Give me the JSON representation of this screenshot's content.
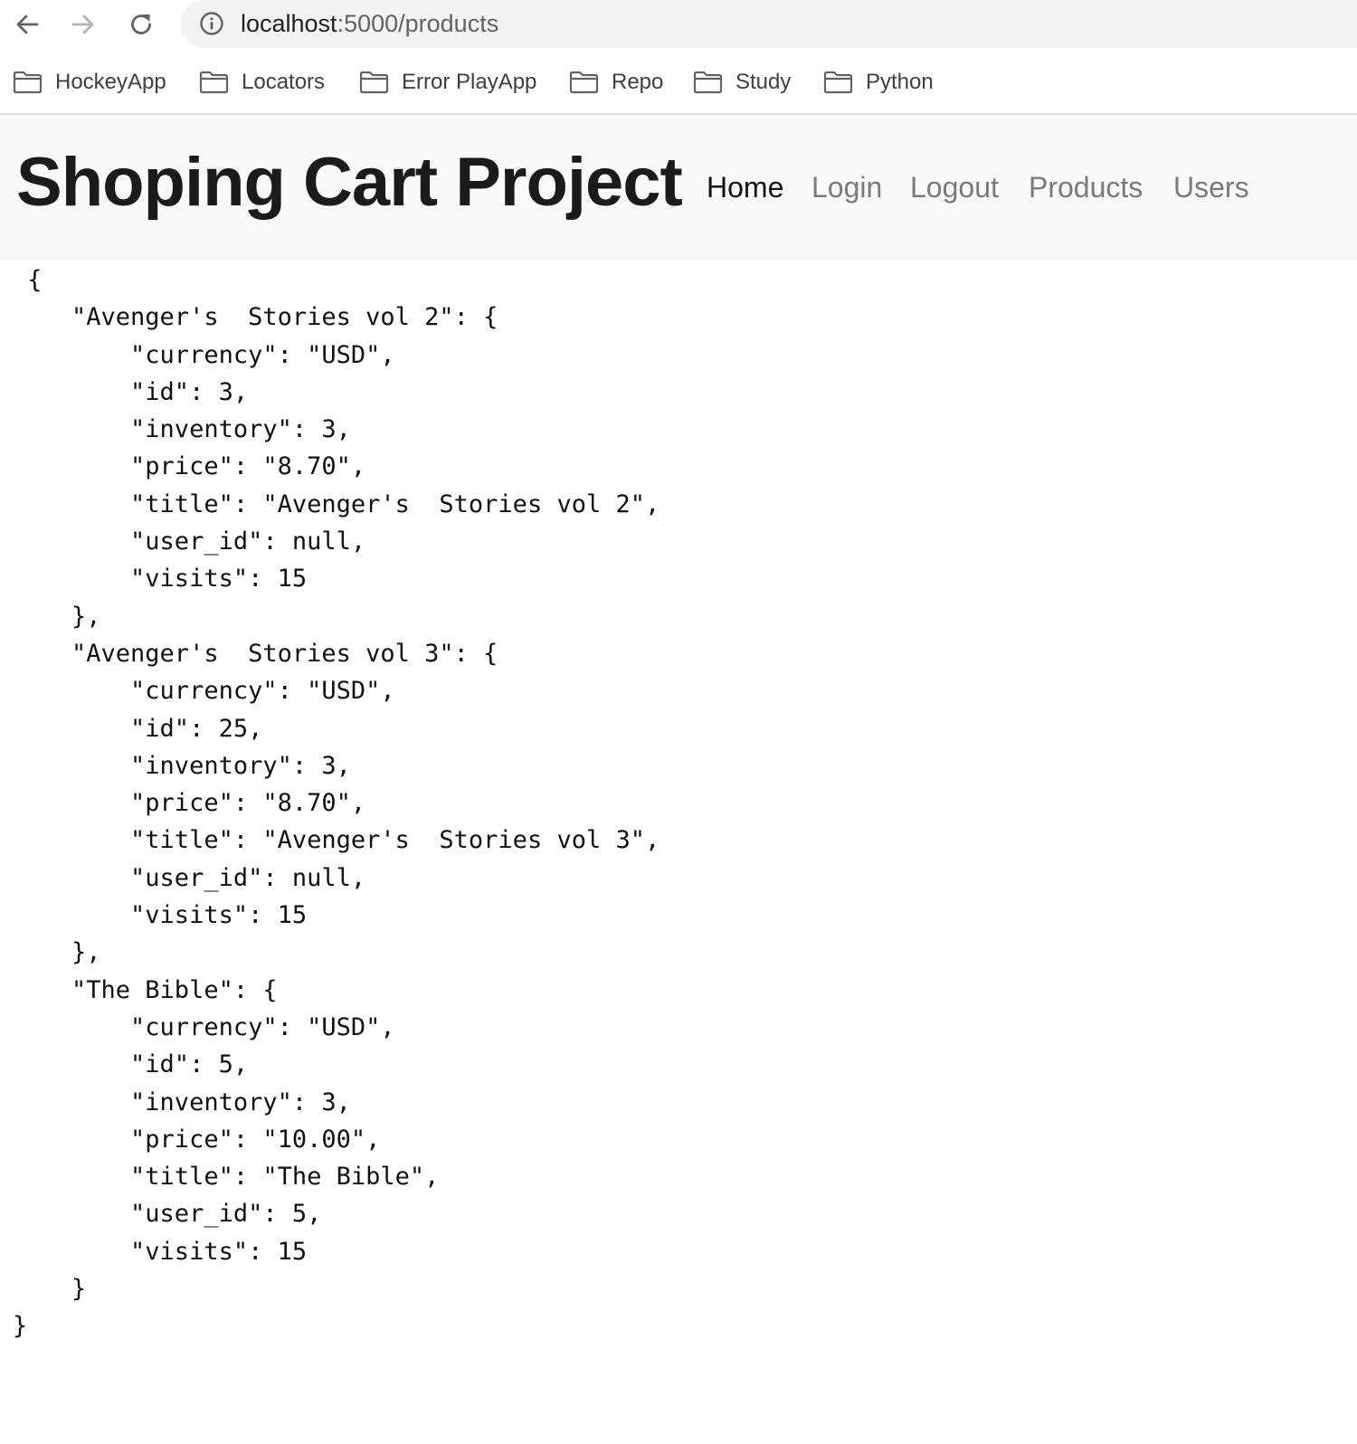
{
  "browser": {
    "url_host": "localhost",
    "url_rest": ":5000/products"
  },
  "bookmarks": [
    {
      "label": "HockeyApp"
    },
    {
      "label": "Locators"
    },
    {
      "label": "Error PlayApp"
    },
    {
      "label": "Repo"
    },
    {
      "label": "Study"
    },
    {
      "label": "Python"
    }
  ],
  "navbar": {
    "brand": "Shoping Cart Project",
    "links": [
      {
        "label": "Home",
        "active": true
      },
      {
        "label": "Login",
        "active": false
      },
      {
        "label": "Logout",
        "active": false
      },
      {
        "label": "Products",
        "active": false
      },
      {
        "label": "Users",
        "active": false
      }
    ]
  },
  "json_body": " {\n    \"Avenger's  Stories vol 2\": {\n        \"currency\": \"USD\",\n        \"id\": 3,\n        \"inventory\": 3,\n        \"price\": \"8.70\",\n        \"title\": \"Avenger's  Stories vol 2\",\n        \"user_id\": null,\n        \"visits\": 15\n    },\n    \"Avenger's  Stories vol 3\": {\n        \"currency\": \"USD\",\n        \"id\": 25,\n        \"inventory\": 3,\n        \"price\": \"8.70\",\n        \"title\": \"Avenger's  Stories vol 3\",\n        \"user_id\": null,\n        \"visits\": 15\n    },\n    \"The Bible\": {\n        \"currency\": \"USD\",\n        \"id\": 5,\n        \"inventory\": 3,\n        \"price\": \"10.00\",\n        \"title\": \"The Bible\",\n        \"user_id\": 5,\n        \"visits\": 15\n    }\n}",
  "icons": {
    "back": "back-arrow-icon",
    "forward": "forward-arrow-icon",
    "reload": "reload-icon",
    "site_info": "info-icon",
    "bookmark_folder": "folder-icon"
  }
}
